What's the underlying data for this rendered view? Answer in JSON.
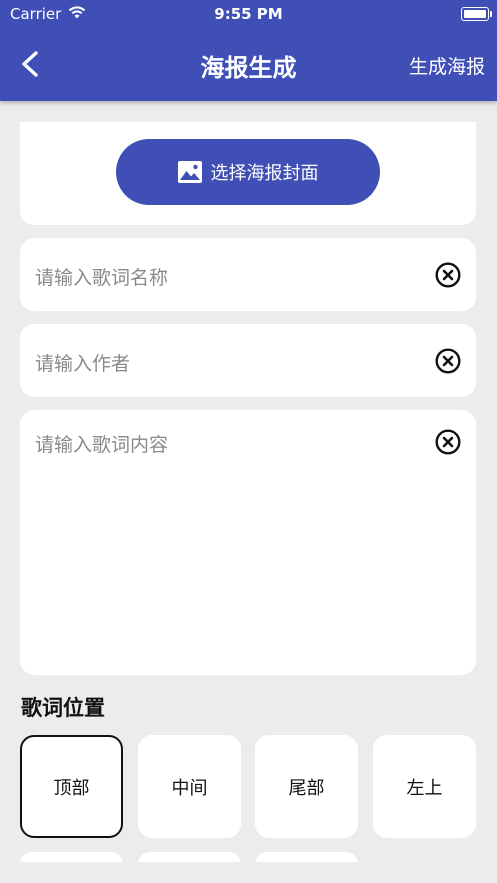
{
  "status_bar": {
    "carrier": "Carrier",
    "time": "9:55 PM"
  },
  "appbar": {
    "title": "海报生成",
    "action": "生成海报",
    "back_icon": "chevron-left-icon"
  },
  "cover": {
    "button_label": "选择海报封面",
    "icon": "image-icon"
  },
  "fields": {
    "lyric_name": {
      "placeholder": "请输入歌词名称",
      "value": ""
    },
    "author": {
      "placeholder": "请输入作者",
      "value": ""
    },
    "lyric_content": {
      "placeholder": "请输入歌词内容",
      "value": ""
    }
  },
  "position": {
    "title": "歌词位置",
    "options": [
      "顶部",
      "中间",
      "尾部",
      "左上"
    ],
    "selected": "顶部"
  },
  "colors": {
    "primary": "#3f4fb5",
    "background": "#ececec",
    "card": "#ffffff"
  }
}
